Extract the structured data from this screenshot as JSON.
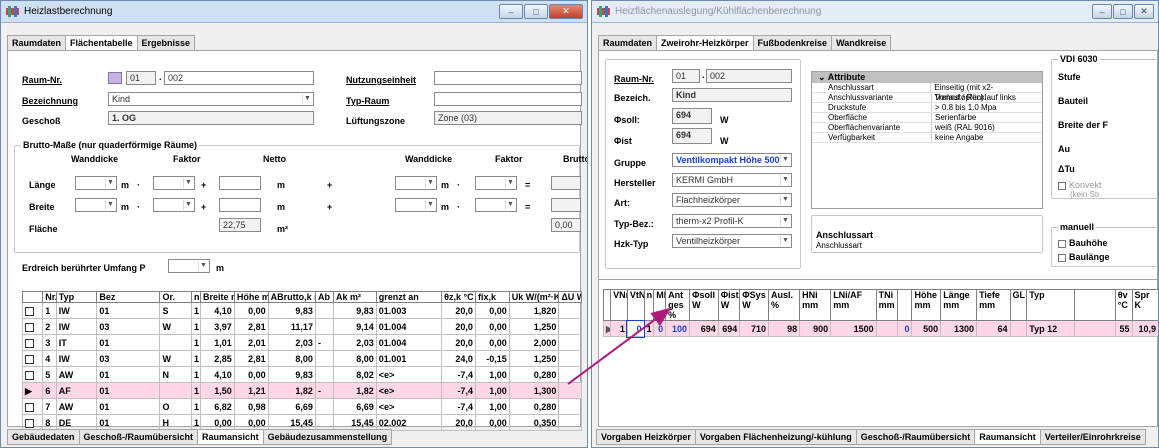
{
  "left": {
    "title": "Heizlastberechnung",
    "controls": [
      "–",
      "□",
      "✕"
    ],
    "tabs": [
      "Raumdaten",
      "Flächentabelle",
      "Ergebnisse"
    ],
    "raum_nr_label": "Raum-Nr.",
    "raum_nr_1": "01",
    "raum_nr_2": "002",
    "bezeichnung_label": "Bezeichnung",
    "bezeichnung": "Kind",
    "geschoss_label": "Geschoß",
    "geschoss": "1. OG",
    "nutzungseinheit_label": "Nutzungseinheit",
    "typ_raum_label": "Typ-Raum",
    "lueftungszone_label": "Lüftungszone",
    "lueftungszone": "Zone (03)",
    "brutto_title": "Brutto-Maße (nur quaderförmige Räume)",
    "col_wanddicke": "Wanddicke",
    "col_faktor": "Faktor",
    "col_netto": "Netto",
    "col_wanddicke2": "Wanddicke",
    "col_faktor2": "Faktor",
    "col_brutto": "Brutto",
    "laenge_label": "Länge",
    "breite_label": "Breite",
    "flaeche_label": "Fläche",
    "unit_m": "m",
    "unit_m2": "m²",
    "netto_flaeche": "22,75",
    "brutto_flaeche": "0,00",
    "erdreich_label": "Erdreich berührter Umfang  P",
    "table_headers": [
      "",
      "Nr.",
      "Typ",
      "Bez",
      "Or.",
      "n",
      "Breite m",
      "Höhe m",
      "ABrutto,k m²",
      "Ab",
      "Ak m²",
      "grenzt an",
      "θz,k °C",
      "fix,k",
      "Uk W/(m²·K)",
      "ΔU W/"
    ],
    "rows": [
      [
        "",
        "1",
        "IW",
        "01",
        "S",
        "1",
        "4,10",
        "0,00",
        "9,83",
        "",
        "9,83",
        "01.003",
        "20,0",
        "0,00",
        "1,820",
        ""
      ],
      [
        "",
        "2",
        "IW",
        "03",
        "W",
        "1",
        "3,97",
        "2,81",
        "11,17",
        "",
        "9,14",
        "01.004",
        "20,0",
        "0,00",
        "1,250",
        ""
      ],
      [
        "",
        "3",
        "IT",
        "01",
        "",
        "1",
        "1,01",
        "2,01",
        "2,03",
        "-",
        "2,03",
        "01.004",
        "20,0",
        "0,00",
        "2,000",
        ""
      ],
      [
        "",
        "4",
        "IW",
        "03",
        "W",
        "1",
        "2,85",
        "2,81",
        "8,00",
        "",
        "8,00",
        "01.001",
        "24,0",
        "-0,15",
        "1,250",
        ""
      ],
      [
        "",
        "5",
        "AW",
        "01",
        "N",
        "1",
        "4,10",
        "0,00",
        "9,83",
        "",
        "8,02",
        "<e>",
        "-7,4",
        "1,00",
        "0,280",
        ""
      ],
      [
        "",
        "6",
        "AF",
        "01",
        "",
        "1",
        "1,50",
        "1,21",
        "1,82",
        "-",
        "1,82",
        "<e>",
        "-7,4",
        "1,00",
        "1,300",
        ""
      ],
      [
        "",
        "7",
        "AW",
        "01",
        "O",
        "1",
        "6,82",
        "0,98",
        "6,69",
        "",
        "6,69",
        "<e>",
        "-7,4",
        "1,00",
        "0,280",
        ""
      ],
      [
        "",
        "8",
        "DE",
        "01",
        "H",
        "1",
        "0,00",
        "0,00",
        "15,45",
        "",
        "15,45",
        "02.002",
        "20,0",
        "0,00",
        "0,350",
        ""
      ]
    ],
    "bottom_tabs": [
      "Gebäudedaten",
      "Geschoß-/Raumübersicht",
      "Raumansicht",
      "Gebäudezusammenstellung"
    ]
  },
  "right": {
    "title": "Heizflächenauslegung/Kühlflächenberechnung",
    "controls": [
      "–",
      "□",
      "✕"
    ],
    "tabs": [
      "Raumdaten",
      "Zweirohr-Heizkörper",
      "Fußbodenkreise",
      "Wandkreise"
    ],
    "raum_nr_label": "Raum-Nr.",
    "raum_nr_1": "01",
    "raum_nr_2": "002",
    "bezeich_label": "Bezeich.",
    "bezeich": "Kind",
    "phi_soll_label": "Φsoll:",
    "phi_soll": "694",
    "phi_ist_label": "Φist",
    "phi_ist": "694",
    "unit_w": "W",
    "gruppe_label": "Gruppe",
    "gruppe": "Ventilkompakt Höhe 500",
    "hersteller_label": "Hersteller",
    "hersteller": "KERMI GmbH",
    "art_label": "Art:",
    "art": "Flachheizkörper",
    "typbez_label": "Typ-Bez.:",
    "typbez": "therm-x2 Profil-K",
    "hzktyp_label": "Hzk-Typ",
    "hzktyp": "Ventilheizkörper",
    "attr_title": "Attribute",
    "attributes": [
      [
        "Anschlussart",
        "Einseitig (mit x2-Trennstopfen)"
      ],
      [
        "Anschlussvariante",
        "Vorlauf / Rücklauf links"
      ],
      [
        "Druckstufe",
        "> 0.8 bis 1.0 Mpa"
      ],
      [
        "Oberfläche",
        "Serienfarbe"
      ],
      [
        "Oberflächenvariante",
        "weiß (RAL 9016)"
      ],
      [
        "Verfügbarkeit",
        "keine Angabe"
      ]
    ],
    "anschlussart_title": "Anschlussart",
    "anschlussart_sub": "Anschlussart",
    "vdi_title": "VDI 6030",
    "side_labels": [
      "Stufe",
      "Bauteil",
      "Breite der F",
      "Au",
      "ΔTu"
    ],
    "konvekt": "Konvekt",
    "kein_str": "(kein Str",
    "manuell": "manuell",
    "bauhoehe": "Bauhöhe",
    "baulaenge": "Baulänge",
    "table_headers": [
      "",
      "VNr",
      "VtNr",
      "n",
      "ML",
      "Ant ges %",
      "Φsoll W",
      "Φist W",
      "ΦSys W",
      "Ausl. %",
      "HNi mm",
      "LNi/AF mm",
      "TNi mm",
      "",
      "Höhe mm",
      "Länge mm",
      "Tiefe mm",
      "GL",
      "Typ",
      "",
      "θv °C",
      "Spr K"
    ],
    "row": [
      "",
      "1",
      "0",
      "1",
      "0",
      "100",
      "694",
      "694",
      "710",
      "98",
      "900",
      "1500",
      "",
      "0",
      "500",
      "1300",
      "64",
      "",
      "Typ 12",
      "",
      "55",
      "10,9"
    ],
    "bottom_tabs": [
      "Vorgaben Heizkörper",
      "Vorgaben Flächenheizung/-kühlung",
      "Geschoß-/Raumübersicht",
      "Raumansicht",
      "Verteiler/Einrohrkreise"
    ]
  },
  "colors": {
    "selected_row": "#ffd7e6",
    "arrow": "#b0187c",
    "accent_blue": "#1a3fd0"
  }
}
